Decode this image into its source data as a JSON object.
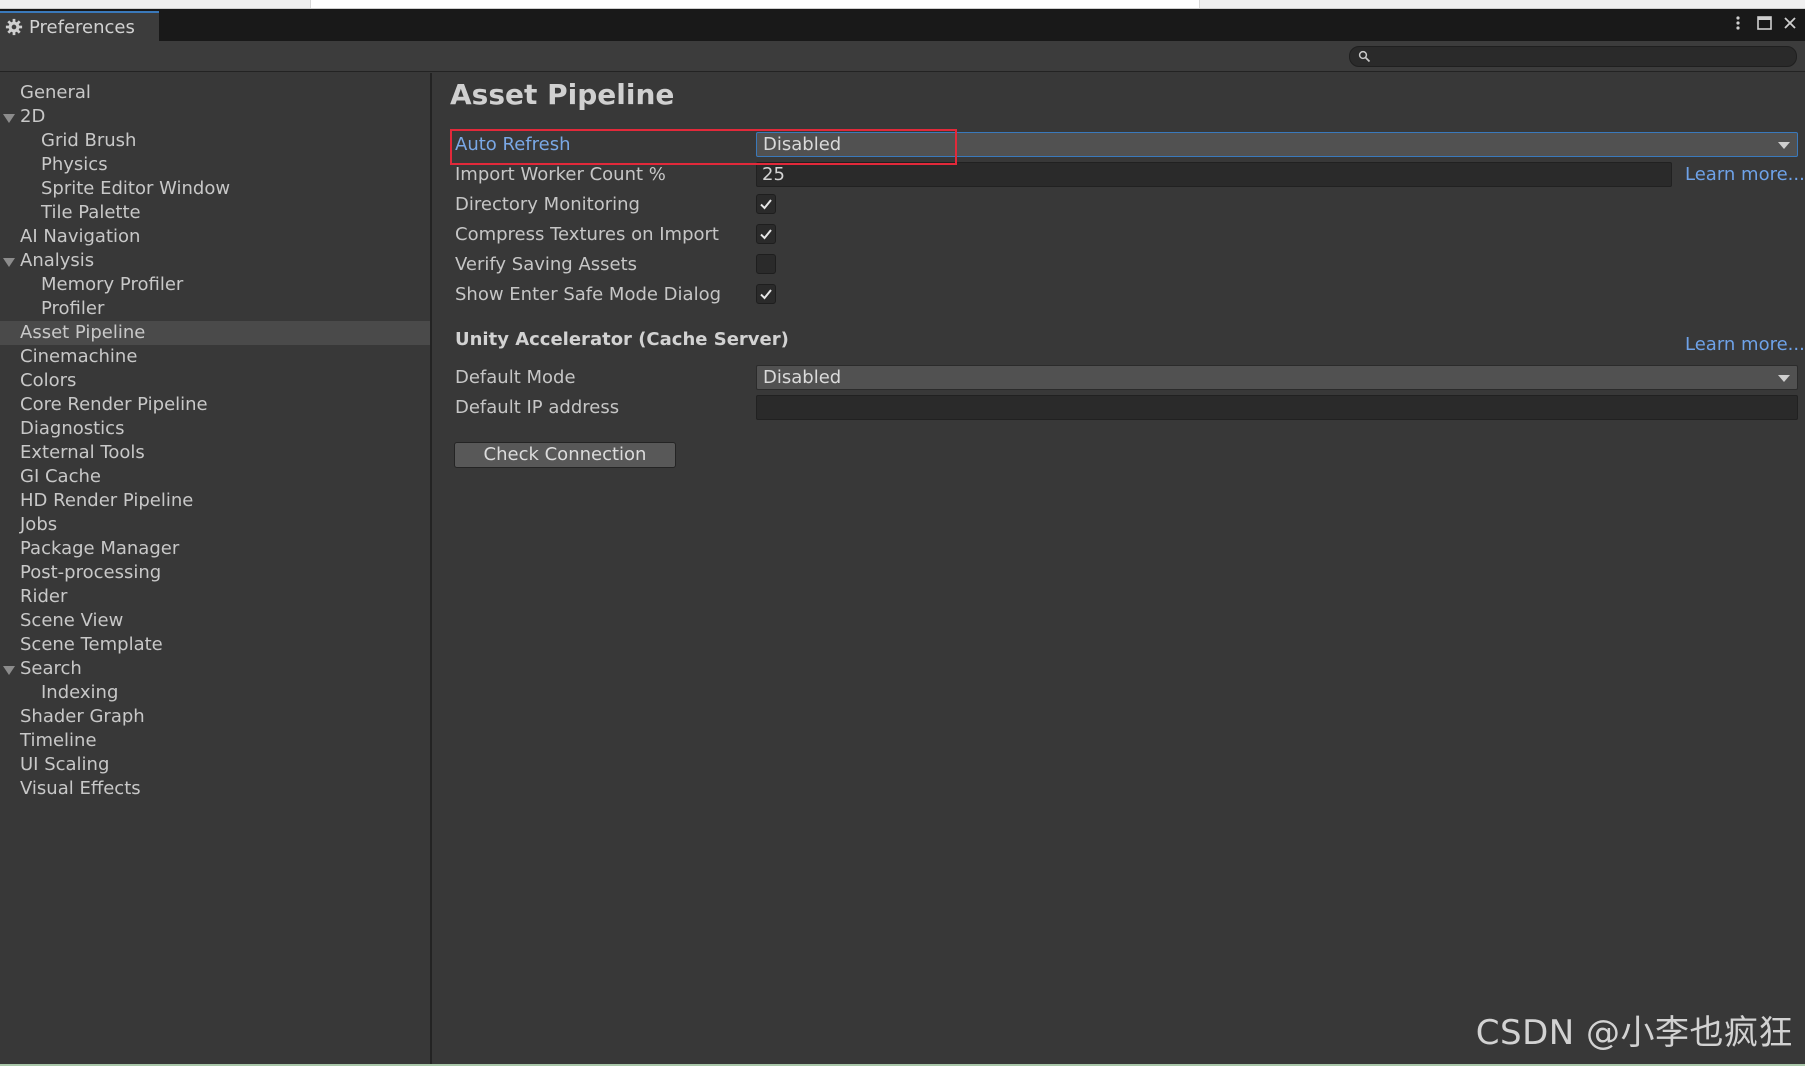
{
  "window": {
    "tab_title": "Preferences"
  },
  "search": {
    "placeholder": ""
  },
  "sidebar": {
    "items": [
      {
        "label": "General",
        "level": 0,
        "foldout": false
      },
      {
        "label": "2D",
        "level": 0,
        "foldout": true
      },
      {
        "label": "Grid Brush",
        "level": 1,
        "foldout": false
      },
      {
        "label": "Physics",
        "level": 1,
        "foldout": false
      },
      {
        "label": "Sprite Editor Window",
        "level": 1,
        "foldout": false
      },
      {
        "label": "Tile Palette",
        "level": 1,
        "foldout": false
      },
      {
        "label": "AI Navigation",
        "level": 0,
        "foldout": false
      },
      {
        "label": "Analysis",
        "level": 0,
        "foldout": true
      },
      {
        "label": "Memory Profiler",
        "level": 1,
        "foldout": false
      },
      {
        "label": "Profiler",
        "level": 1,
        "foldout": false
      },
      {
        "label": "Asset Pipeline",
        "level": 0,
        "foldout": false,
        "selected": true
      },
      {
        "label": "Cinemachine",
        "level": 0,
        "foldout": false
      },
      {
        "label": "Colors",
        "level": 0,
        "foldout": false
      },
      {
        "label": "Core Render Pipeline",
        "level": 0,
        "foldout": false
      },
      {
        "label": "Diagnostics",
        "level": 0,
        "foldout": false
      },
      {
        "label": "External Tools",
        "level": 0,
        "foldout": false
      },
      {
        "label": "GI Cache",
        "level": 0,
        "foldout": false
      },
      {
        "label": "HD Render Pipeline",
        "level": 0,
        "foldout": false
      },
      {
        "label": "Jobs",
        "level": 0,
        "foldout": false
      },
      {
        "label": "Package Manager",
        "level": 0,
        "foldout": false
      },
      {
        "label": "Post-processing",
        "level": 0,
        "foldout": false
      },
      {
        "label": "Rider",
        "level": 0,
        "foldout": false
      },
      {
        "label": "Scene View",
        "level": 0,
        "foldout": false
      },
      {
        "label": "Scene Template",
        "level": 0,
        "foldout": false
      },
      {
        "label": "Search",
        "level": 0,
        "foldout": true
      },
      {
        "label": "Indexing",
        "level": 1,
        "foldout": false
      },
      {
        "label": "Shader Graph",
        "level": 0,
        "foldout": false
      },
      {
        "label": "Timeline",
        "level": 0,
        "foldout": false
      },
      {
        "label": "UI Scaling",
        "level": 0,
        "foldout": false
      },
      {
        "label": "Visual Effects",
        "level": 0,
        "foldout": false
      }
    ]
  },
  "main": {
    "title": "Asset Pipeline",
    "auto_refresh": {
      "label": "Auto Refresh",
      "value": "Disabled"
    },
    "import_worker": {
      "label": "Import Worker Count %",
      "value": "25",
      "learn_more": "Learn more..."
    },
    "directory_monitoring": {
      "label": "Directory Monitoring",
      "checked": true
    },
    "compress_textures": {
      "label": "Compress Textures on Import",
      "checked": true
    },
    "verify_saving": {
      "label": "Verify Saving Assets",
      "checked": false
    },
    "safe_mode_dialog": {
      "label": "Show Enter Safe Mode Dialog",
      "checked": true
    },
    "accelerator": {
      "heading": "Unity Accelerator (Cache Server)",
      "learn_more": "Learn more...",
      "default_mode": {
        "label": "Default Mode",
        "value": "Disabled"
      },
      "default_ip": {
        "label": "Default IP address",
        "value": ""
      },
      "check_button": "Check Connection"
    }
  },
  "watermark": "CSDN @小李也疯狂",
  "colors": {
    "background": "#383838",
    "tab_accent": "#3a79bb",
    "link": "#6ea2e8",
    "highlight_box": "#e2293a"
  }
}
